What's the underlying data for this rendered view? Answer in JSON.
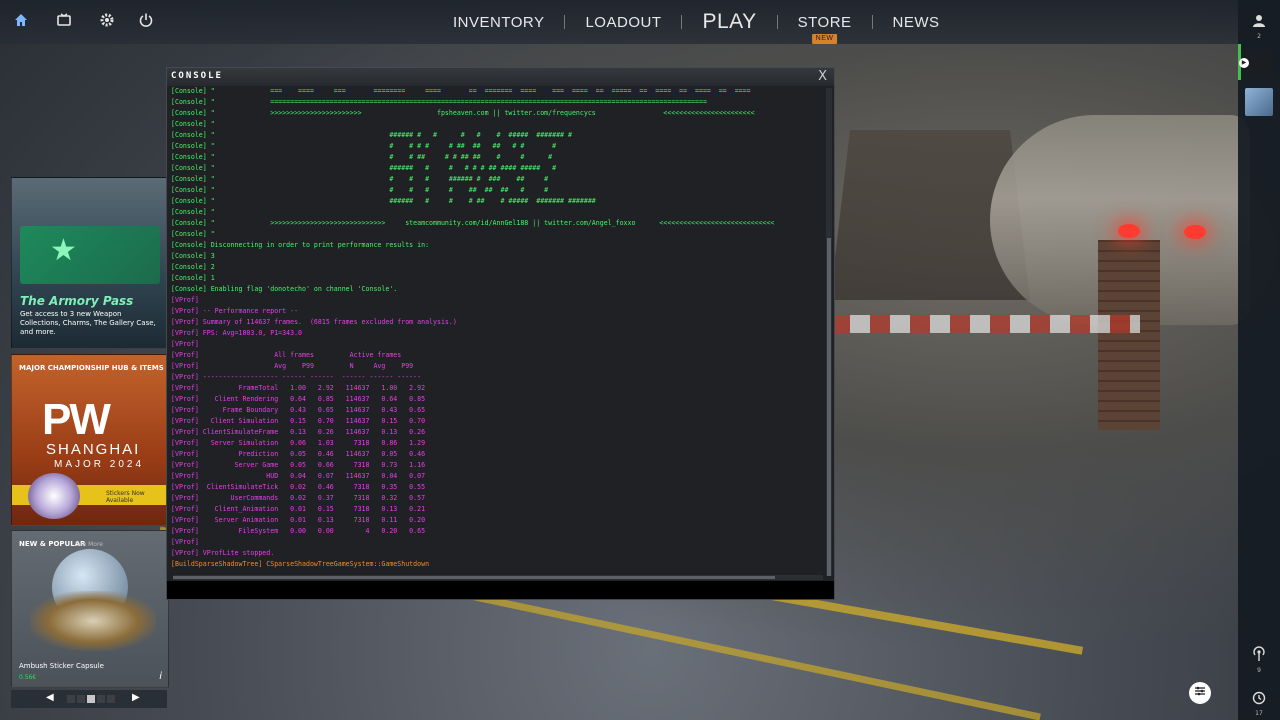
{
  "topbar": {
    "icons": [
      "home-icon",
      "tv-icon",
      "gear-icon",
      "power-icon"
    ],
    "nav": {
      "inventory": "INVENTORY",
      "loadout": "LOADOUT",
      "play": "PLAY",
      "store": "STORE",
      "store_badge": "NEW",
      "news": "NEWS"
    }
  },
  "rightbar": {
    "friends_count": "2",
    "antenna_count": "9",
    "history_count": "17"
  },
  "promos": {
    "armory": {
      "title": "The Armory Pass",
      "desc": "Get access to 3 new Weapon Collections, Charms, The Gallery Case, and more."
    },
    "major": {
      "label": "MAJOR CHAMPIONSHIP HUB & ITEMS",
      "logo": "PW",
      "city": "SHANGHAI",
      "sub": "MAJOR 2024",
      "strip": "Stickers Now Available"
    },
    "new_popular": {
      "label": "NEW & POPULAR",
      "see_more": "See More",
      "name": "Ambush Sticker Capsule",
      "price": "0.56€"
    }
  },
  "console": {
    "title": "CONSOLE",
    "close": "X",
    "lines": [
      {
        "c": "green",
        "t": "[Console] \"              ===    ====     ===       ========     ====       ==  =======  ====    ===  ====  ==  =====  ==  ====  ==  ====  ==  ===="
      },
      {
        "c": "green",
        "t": "[Console] \"              =============================================================================================================="
      },
      {
        "c": "green",
        "t": "[Console] \"              >>>>>>>>>>>>>>>>>>>>>>>                   fpsheaven.com || twitter.com/frequencycs                 <<<<<<<<<<<<<<<<<<<<<<<"
      },
      {
        "c": "green",
        "t": "[Console] \""
      },
      {
        "c": "green",
        "t": "[Console] \"                                            ###### #   #      #   #    #  #####  ####### #"
      },
      {
        "c": "green",
        "t": "[Console] \"                                            #    # # #     # ##  ##   ##   # #       #"
      },
      {
        "c": "green",
        "t": "[Console] \"                                            #    # ##     # # ## ##    #     #      #"
      },
      {
        "c": "green",
        "t": "[Console] \"                                            ######   #     #   # # # ## #### #####   #"
      },
      {
        "c": "green",
        "t": "[Console] \"                                            #    #   #     ###### #  ###    ##     #"
      },
      {
        "c": "green",
        "t": "[Console] \"                                            #    #   #     #    ##  ##  ##   #     #"
      },
      {
        "c": "green",
        "t": "[Console] \"                                            ######   #     #    # ##    # #####  ####### #######"
      },
      {
        "c": "green",
        "t": "[Console] \""
      },
      {
        "c": "green",
        "t": "[Console] \"              >>>>>>>>>>>>>>>>>>>>>>>>>>>>>     steamcommunity.com/id/AnnGel188 || twitter.com/Angel_foxxo      <<<<<<<<<<<<<<<<<<<<<<<<<<<<<"
      },
      {
        "c": "green",
        "t": "[Console] \""
      },
      {
        "c": "green",
        "t": "[Console] Disconnecting in order to print performance results in:"
      },
      {
        "c": "green",
        "t": "[Console] 3"
      },
      {
        "c": "green",
        "t": "[Console] 2"
      },
      {
        "c": "green",
        "t": "[Console] 1"
      },
      {
        "c": "green",
        "t": "[Console] Enabling flag 'donotecho' on channel 'Console'."
      },
      {
        "c": "magenta",
        "t": "[VProf]"
      },
      {
        "c": "magenta",
        "t": "[VProf] -- Performance report --"
      },
      {
        "c": "magenta",
        "t": "[VProf] Summary of 114637 frames.  (6815 frames excluded from analysis.)"
      },
      {
        "c": "magenta",
        "t": "[VProf] FPS: Avg=1003.0, P1=343.0"
      },
      {
        "c": "magenta",
        "t": "[VProf]"
      },
      {
        "c": "magenta",
        "t": "[VProf]                   All frames         Active frames"
      },
      {
        "c": "magenta",
        "t": "[VProf]                   Avg    P99         N     Avg    P99"
      },
      {
        "c": "magenta",
        "t": "[VProf] ------------------- ------ ------  ------ ------ ------"
      },
      {
        "c": "magenta",
        "t": "[VProf]          FrameTotal   1.00   2.92   114637   1.00   2.92"
      },
      {
        "c": "magenta",
        "t": "[VProf]    Client Rendering   0.64   0.85   114637   0.64   0.85"
      },
      {
        "c": "magenta",
        "t": "[VProf]      Frame Boundary   0.43   0.65   114637   0.43   0.65"
      },
      {
        "c": "magenta",
        "t": "[VProf]   Client Simulation   0.15   0.70   114637   0.15   0.70"
      },
      {
        "c": "magenta",
        "t": "[VProf] ClientSimulateFrame   0.13   0.26   114637   0.13   0.26"
      },
      {
        "c": "magenta",
        "t": "[VProf]   Server Simulation   0.06   1.03     7318   0.86   1.29"
      },
      {
        "c": "magenta",
        "t": "[VProf]          Prediction   0.05   0.46   114637   0.05   0.46"
      },
      {
        "c": "magenta",
        "t": "[VProf]         Server Game   0.05   0.66     7318   0.73   1.16"
      },
      {
        "c": "magenta",
        "t": "[VProf]                 HUD   0.04   0.07   114637   0.04   0.07"
      },
      {
        "c": "magenta",
        "t": "[VProf]  ClientSimulateTick   0.02   0.46     7318   0.35   0.55"
      },
      {
        "c": "magenta",
        "t": "[VProf]        UserCommands   0.02   0.37     7318   0.32   0.57"
      },
      {
        "c": "magenta",
        "t": "[VProf]    Client_Animation   0.01   0.15     7318   0.13   0.21"
      },
      {
        "c": "magenta",
        "t": "[VProf]    Server Animation   0.01   0.13     7318   0.11   0.20"
      },
      {
        "c": "magenta",
        "t": "[VProf]          FileSystem   0.00   0.00        4   0.20   0.65"
      },
      {
        "c": "magenta",
        "t": "[VProf]"
      },
      {
        "c": "magenta",
        "t": "[VProf] VProfLite stopped."
      },
      {
        "c": "orange",
        "t": "[BuildSparseShadowTree] CSparseShadowTreeGameSystem::GameShutdown"
      }
    ]
  },
  "colors": {
    "accent_green": "#47f56a",
    "console_magenta": "#e83fe9",
    "console_orange": "#f48b23",
    "badge_orange": "#d7822a"
  }
}
